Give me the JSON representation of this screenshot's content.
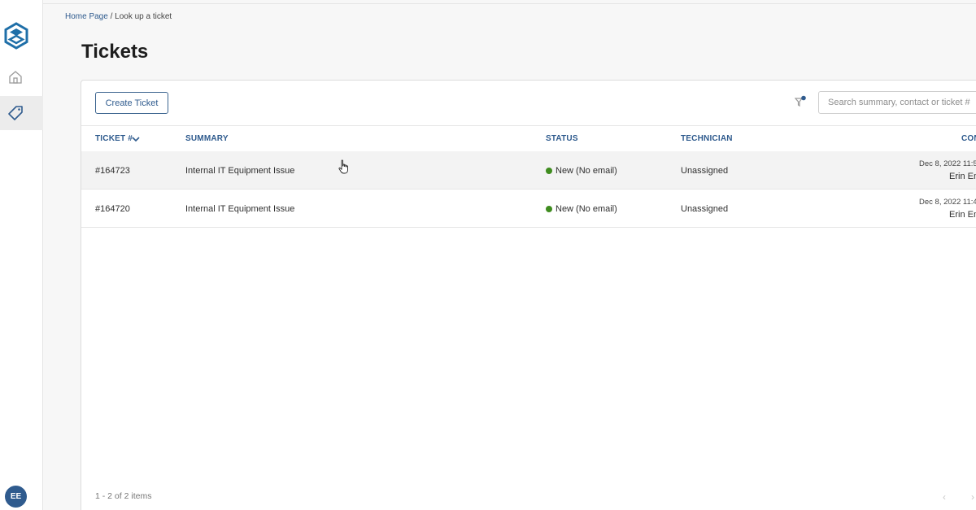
{
  "breadcrumb": {
    "home": "Home Page",
    "separator": " / ",
    "current": "Look up a ticket"
  },
  "page_title": "Tickets",
  "toolbar": {
    "create_label": "Create Ticket",
    "search_placeholder": "Search summary, contact or ticket #"
  },
  "table": {
    "headers": {
      "ticket": "TICKET #",
      "summary": "SUMMARY",
      "status": "STATUS",
      "technician": "TECHNICIAN",
      "contact": "CON"
    },
    "rows": [
      {
        "ticket": "#164723",
        "summary": "Internal IT Equipment Issue",
        "status": "New (No email)",
        "technician": "Unassigned",
        "date": "Dec 8, 2022 11:5",
        "contact": "Erin Em"
      },
      {
        "ticket": "#164720",
        "summary": "Internal IT Equipment Issue",
        "status": "New (No email)",
        "technician": "Unassigned",
        "date": "Dec 8, 2022 11:4",
        "contact": "Erin Em"
      }
    ]
  },
  "footer": {
    "count": "1 - 2 of 2 items",
    "prev": "‹",
    "next": "›"
  },
  "user": {
    "initials": "EE"
  },
  "colors": {
    "accent": "#2f5b8e",
    "status_new": "#3f8c1f",
    "logo": "#1f6fa8"
  }
}
